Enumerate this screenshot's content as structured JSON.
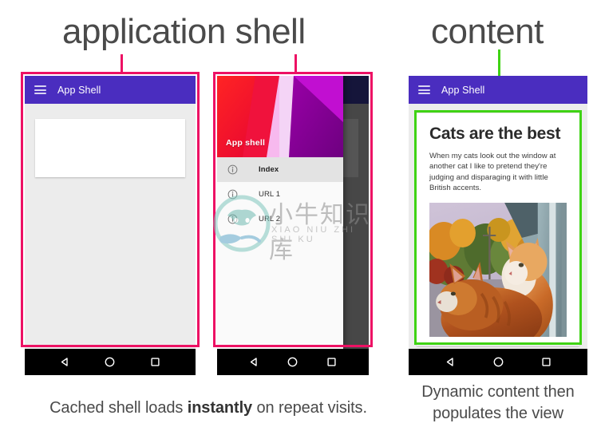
{
  "annotations": {
    "app_shell_label": "application shell",
    "content_label": "content",
    "pink_color": "#ED1164",
    "green_color": "#3FD314"
  },
  "captions": {
    "left_before": "Cached shell loads ",
    "left_strong": "instantly",
    "left_after": " on repeat visits.",
    "right": "Dynamic content then populates the view"
  },
  "phone_one": {
    "appbar": {
      "menu_icon": "hamburger-icon",
      "title": "App Shell"
    },
    "card_state": ""
  },
  "phone_two": {
    "drawer": {
      "header_title": "App shell",
      "items": [
        {
          "icon": "info-circle-icon",
          "label": "Index",
          "selected": true
        },
        {
          "icon": "info-circle-icon",
          "label": "URL 1",
          "selected": false
        },
        {
          "icon": "info-circle-icon",
          "label": "URL 2",
          "selected": false
        }
      ]
    }
  },
  "phone_three": {
    "appbar": {
      "menu_icon": "hamburger-icon",
      "title": "App Shell"
    },
    "article": {
      "title": "Cats are the best",
      "body": "When my cats look out the window at another cat I like to pretend they're judging and disparaging it with little British accents.",
      "image_alt": "two orange tabby cats looking out a window"
    }
  },
  "navbar": {
    "back_icon": "back-triangle-icon",
    "home_icon": "home-circle-icon",
    "recents_icon": "recents-square-icon"
  },
  "watermark": {
    "chinese": "小牛知识库",
    "pinyin": "XIAO NIU ZHI SHI KU"
  }
}
